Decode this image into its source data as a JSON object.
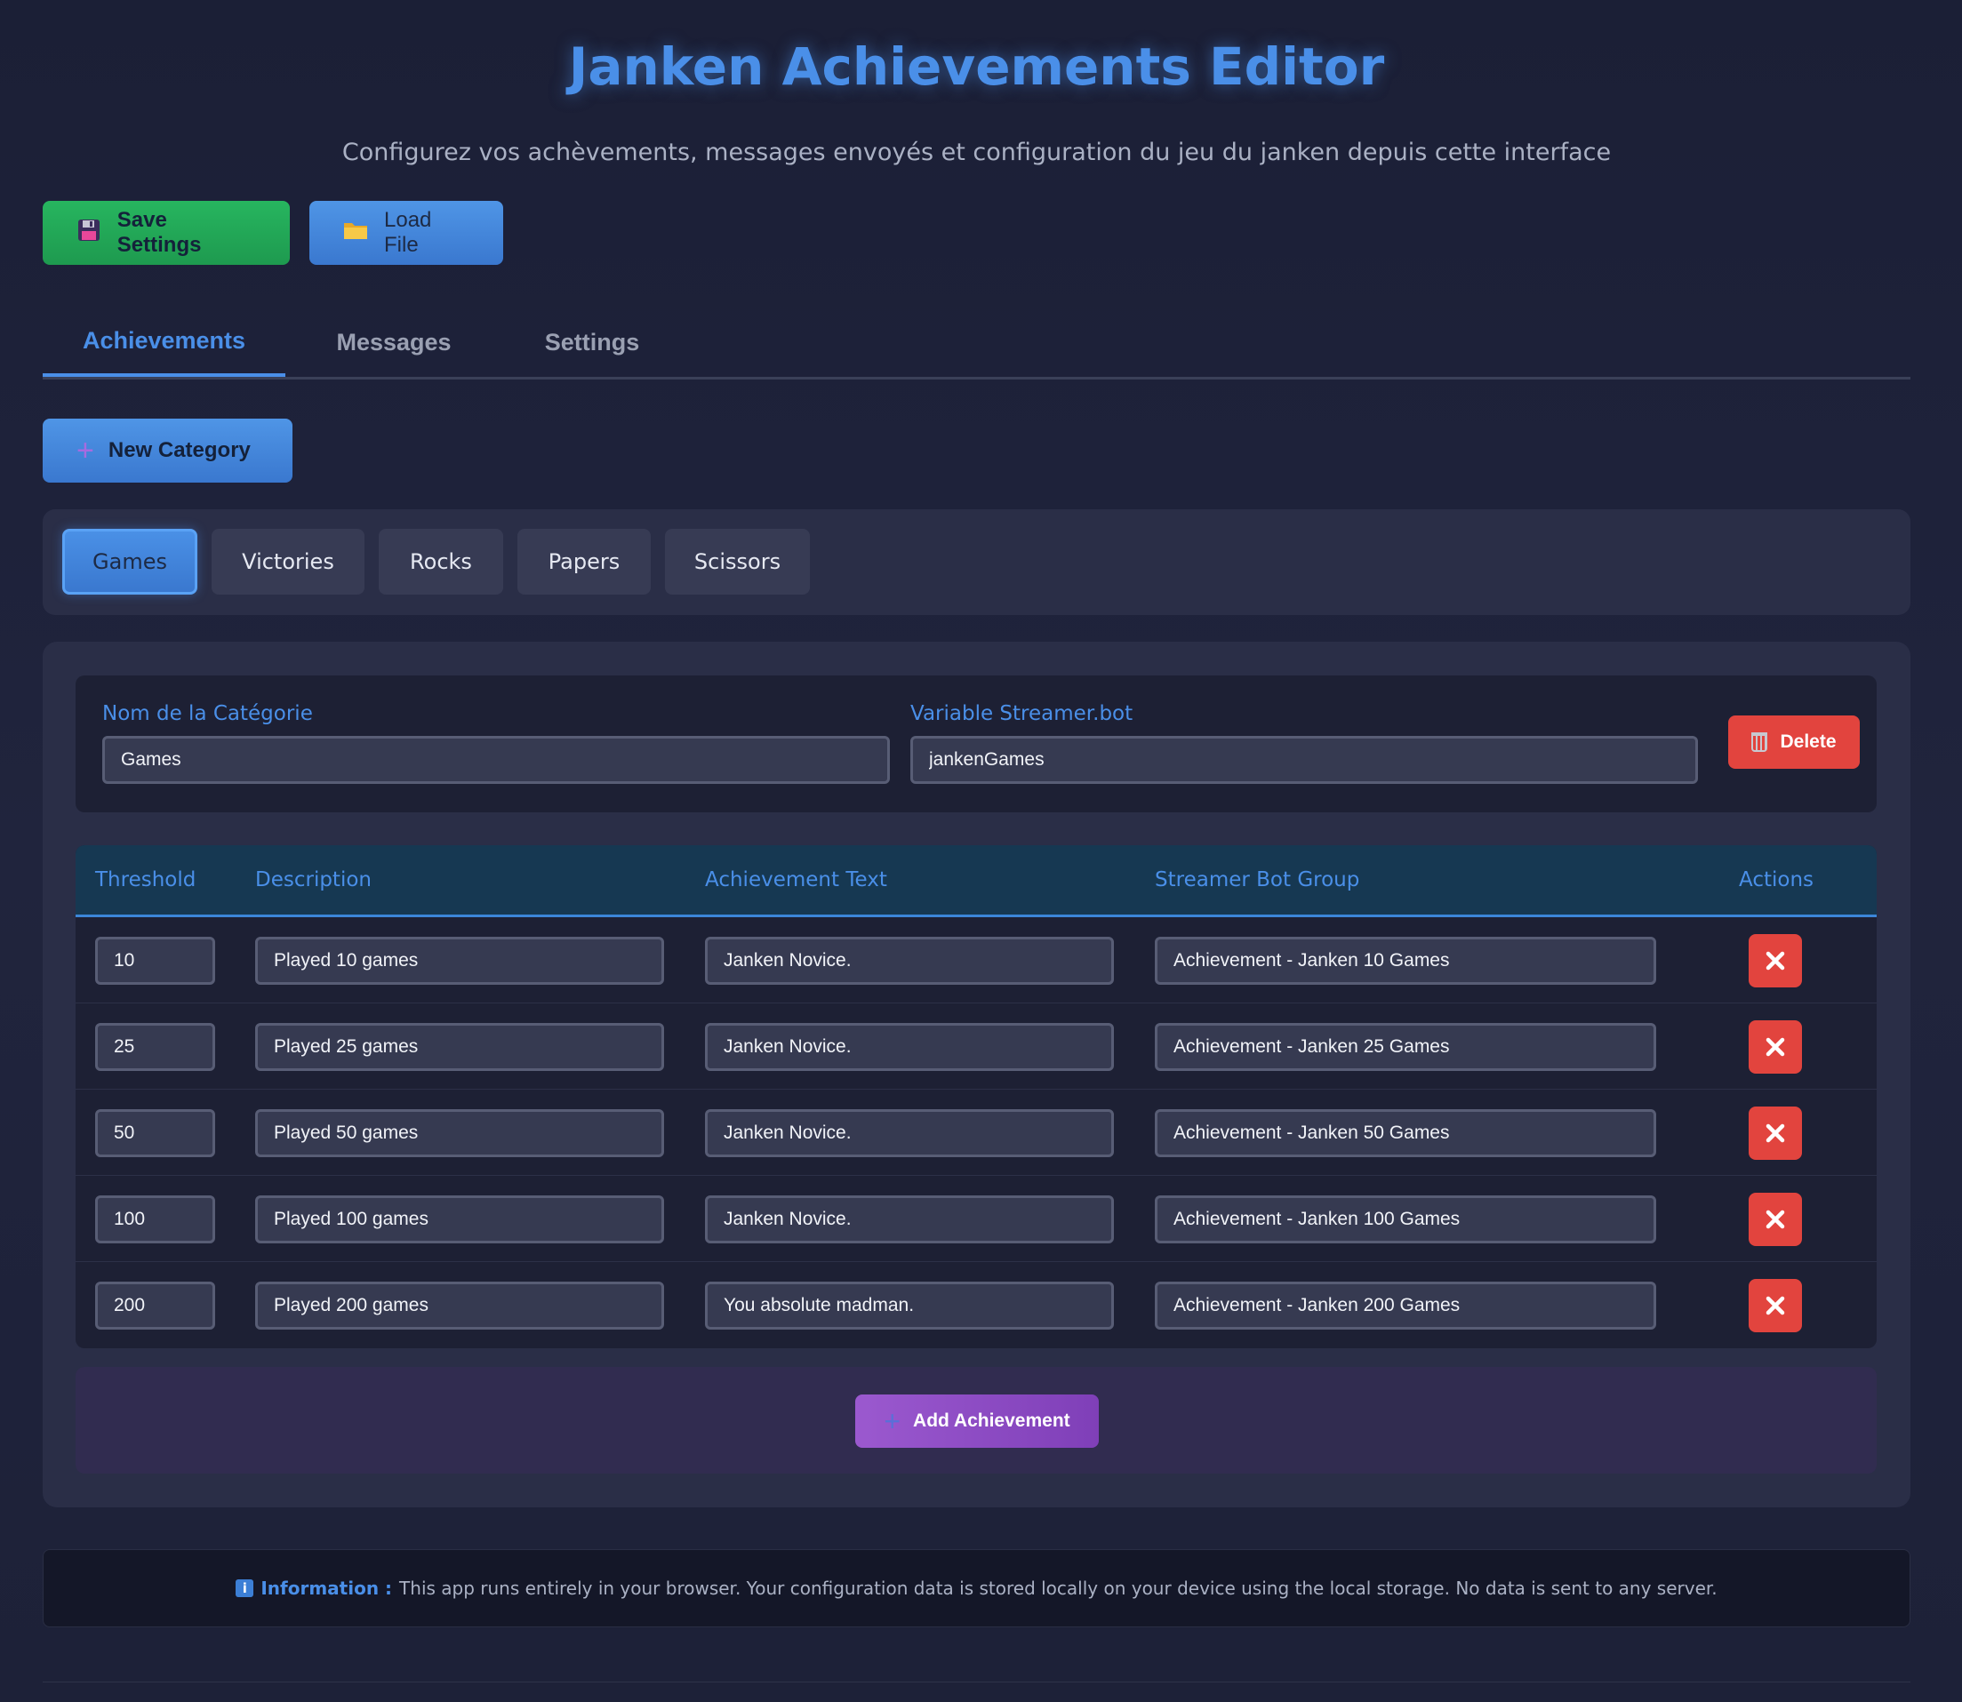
{
  "header": {
    "title": "Janken Achievements Editor",
    "subtitle": "Configurez vos achèvements, messages envoyés et configuration du jeu du janken depuis cette interface"
  },
  "toolbar": {
    "save_label": "Save Settings",
    "save_icon": "floppy-disk-icon",
    "load_label": "Load File",
    "load_icon": "folder-icon"
  },
  "tabs": [
    {
      "label": "Achievements",
      "active": true
    },
    {
      "label": "Messages",
      "active": false
    },
    {
      "label": "Settings",
      "active": false
    }
  ],
  "new_category_label": "New Category",
  "categories": [
    {
      "label": "Games",
      "active": true
    },
    {
      "label": "Victories",
      "active": false
    },
    {
      "label": "Rocks",
      "active": false
    },
    {
      "label": "Papers",
      "active": false
    },
    {
      "label": "Scissors",
      "active": false
    }
  ],
  "category_form": {
    "name_label": "Nom de la Catégorie",
    "name_value": "Games",
    "variable_label": "Variable Streamer.bot",
    "variable_value": "jankenGames",
    "delete_label": "Delete"
  },
  "table": {
    "headers": [
      "Threshold",
      "Description",
      "Achievement Text",
      "Streamer Bot Group",
      "Actions"
    ],
    "rows": [
      {
        "threshold": "10",
        "description": "Played 10 games",
        "text": "Janken Novice.",
        "group": "Achievement - Janken 10 Games"
      },
      {
        "threshold": "25",
        "description": "Played 25 games",
        "text": "Janken Novice.",
        "group": "Achievement - Janken 25 Games"
      },
      {
        "threshold": "50",
        "description": "Played 50 games",
        "text": "Janken Novice.",
        "group": "Achievement - Janken 50 Games"
      },
      {
        "threshold": "100",
        "description": "Played 100 games",
        "text": "Janken Novice.",
        "group": "Achievement - Janken 100 Games"
      },
      {
        "threshold": "200",
        "description": "Played 200 games",
        "text": "You absolute madman.",
        "group": "Achievement - Janken 200 Games"
      }
    ]
  },
  "add_achievement_label": "Add Achievement",
  "info": {
    "label": "Information :",
    "text": "This app runs entirely in your browser. Your configuration data is stored locally on your device using the local storage. No data is sent to any server."
  },
  "colors": {
    "accent": "#4a8fe8",
    "save": "#27b55f",
    "danger": "#e2443e",
    "add": "#9b59cf",
    "background": "#1b1f36"
  }
}
